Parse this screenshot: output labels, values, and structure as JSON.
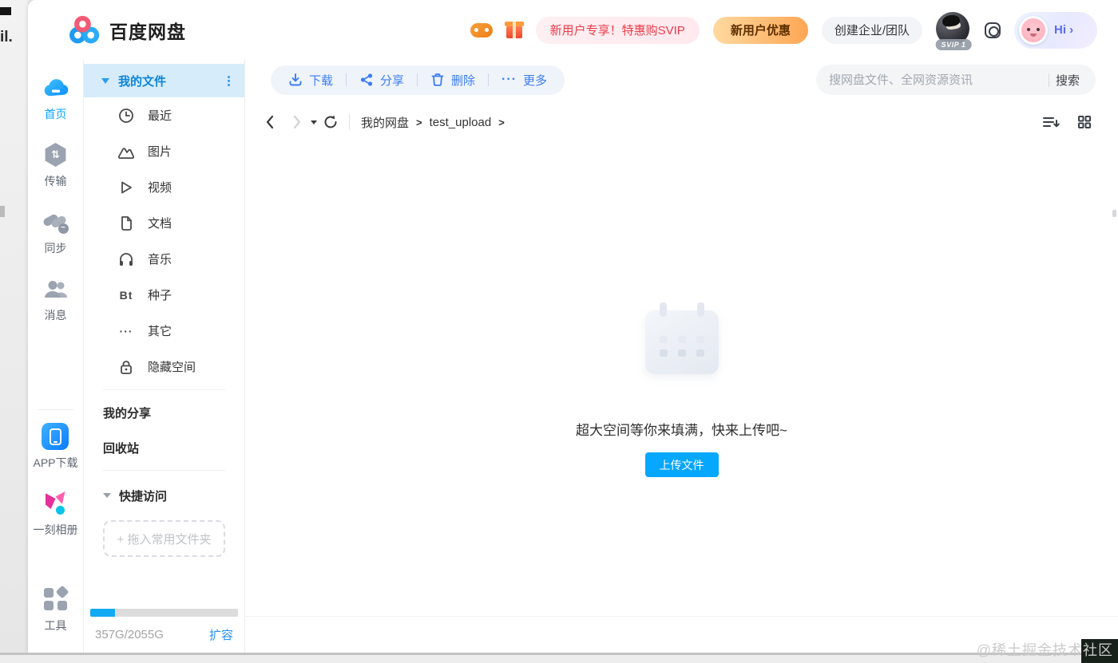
{
  "window": {
    "brand": "百度网盘",
    "watermark": "@稀土掘金技术社区",
    "background_artifact": "il."
  },
  "header": {
    "promo_pill": "新用户专享！特惠购SVIP",
    "promo_button": "新用户优惠",
    "create_team": "创建企业/团队",
    "svip_badge": "SVIP 1",
    "assistant_label": "Hi ›",
    "icons": [
      "gamepad-icon",
      "gift-icon",
      "user-avatar",
      "settings-ring-icon",
      "assistant-avatar"
    ]
  },
  "nav_rail": {
    "items": [
      {
        "label": "首页",
        "icon": "cloud",
        "active": true
      },
      {
        "label": "传输",
        "icon": "transfer",
        "active": false
      },
      {
        "label": "同步",
        "icon": "sync",
        "active": false
      },
      {
        "label": "消息",
        "icon": "messages",
        "active": false
      },
      {
        "label": "APP下载",
        "icon": "app-download",
        "active": false
      },
      {
        "label": "一刻相册",
        "icon": "photo-album",
        "active": false
      },
      {
        "label": "工具",
        "icon": "tools",
        "active": false
      }
    ]
  },
  "file_tree": {
    "root": "我的文件",
    "items": [
      {
        "label": "最近",
        "icon": "clock"
      },
      {
        "label": "图片",
        "icon": "picture"
      },
      {
        "label": "视频",
        "icon": "video"
      },
      {
        "label": "文档",
        "icon": "document"
      },
      {
        "label": "音乐",
        "icon": "music"
      },
      {
        "label": "种子",
        "icon": "bt"
      },
      {
        "label": "其它",
        "icon": "ellipsis"
      },
      {
        "label": "隐藏空间",
        "icon": "lock"
      }
    ],
    "bt_glyph": "Bt",
    "ellipsis_glyph": "···",
    "links": [
      {
        "label": "我的分享"
      },
      {
        "label": "回收站"
      }
    ],
    "quick_access": "快捷访问",
    "drop_hint": "+ 拖入常用文件夹",
    "storage": {
      "text": "357G/2055G",
      "expand": "扩容",
      "percent": 17
    }
  },
  "toolbar": {
    "download": "下载",
    "share": "分享",
    "delete": "删除",
    "more": "更多",
    "more_glyph": "···",
    "search_placeholder": "搜网盘文件、全网资源资讯",
    "search_button": "搜索"
  },
  "breadcrumb": {
    "root": "我的网盘",
    "folder": "test_upload",
    "separator": ">"
  },
  "empty_state": {
    "message": "超大空间等你来填满，快来上传吧~",
    "upload_button": "上传文件"
  },
  "colors": {
    "accent": "#06a7ff",
    "toolbar_blue": "#3b7cf3",
    "selected_row_bg": "#d6ecfa",
    "promo_red": "#ee3b49",
    "promo_orange_from": "#ffd9a0",
    "promo_orange_to": "#ffa654"
  }
}
